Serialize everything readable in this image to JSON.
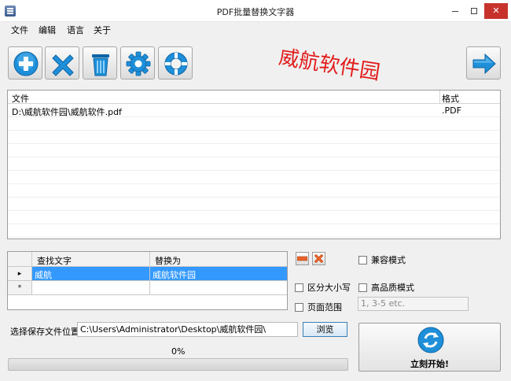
{
  "window": {
    "title": "PDF批量替换文字器",
    "close_glyph": "✕"
  },
  "menu": [
    "文件",
    "编辑",
    "语言",
    "关于"
  ],
  "toolbar": {
    "buttons": [
      {
        "name": "add-button",
        "icon": "plus-circle-icon"
      },
      {
        "name": "remove-button",
        "icon": "x-icon"
      },
      {
        "name": "clear-button",
        "icon": "trash-icon"
      },
      {
        "name": "settings-button",
        "icon": "gear-icon"
      },
      {
        "name": "help-button",
        "icon": "lifebuoy-icon"
      },
      {
        "name": "next-button",
        "icon": "arrow-right-icon"
      }
    ]
  },
  "watermark": "威航软件园",
  "file_list": {
    "columns": [
      "文件",
      "格式"
    ],
    "rows": [
      {
        "file": "D:\\威航软件园\\威航软件.pdf",
        "format": ".PDF"
      }
    ]
  },
  "replace_grid": {
    "columns": [
      "查找文字",
      "替换为"
    ],
    "rows": [
      {
        "marker": "▸",
        "find": "威航",
        "replace": "威航软件园"
      },
      {
        "marker": "*",
        "find": "",
        "replace": ""
      }
    ]
  },
  "options": {
    "compat_mode": "兼容模式",
    "case_sensitive": "区分大小写",
    "high_quality": "高品质模式",
    "page_range": "页面范围",
    "page_range_placeholder": "1, 3-5 etc."
  },
  "save": {
    "label": "选择保存文件位置",
    "path": "C:\\Users\\Administrator\\Desktop\\威航软件园\\",
    "browse": "浏览"
  },
  "progress": {
    "text": "0%",
    "value": 0
  },
  "start_label": "立刻开始!",
  "colors": {
    "accent": "#1e8fd8",
    "watermark": "#e21b1b",
    "selection": "#3399ff"
  }
}
